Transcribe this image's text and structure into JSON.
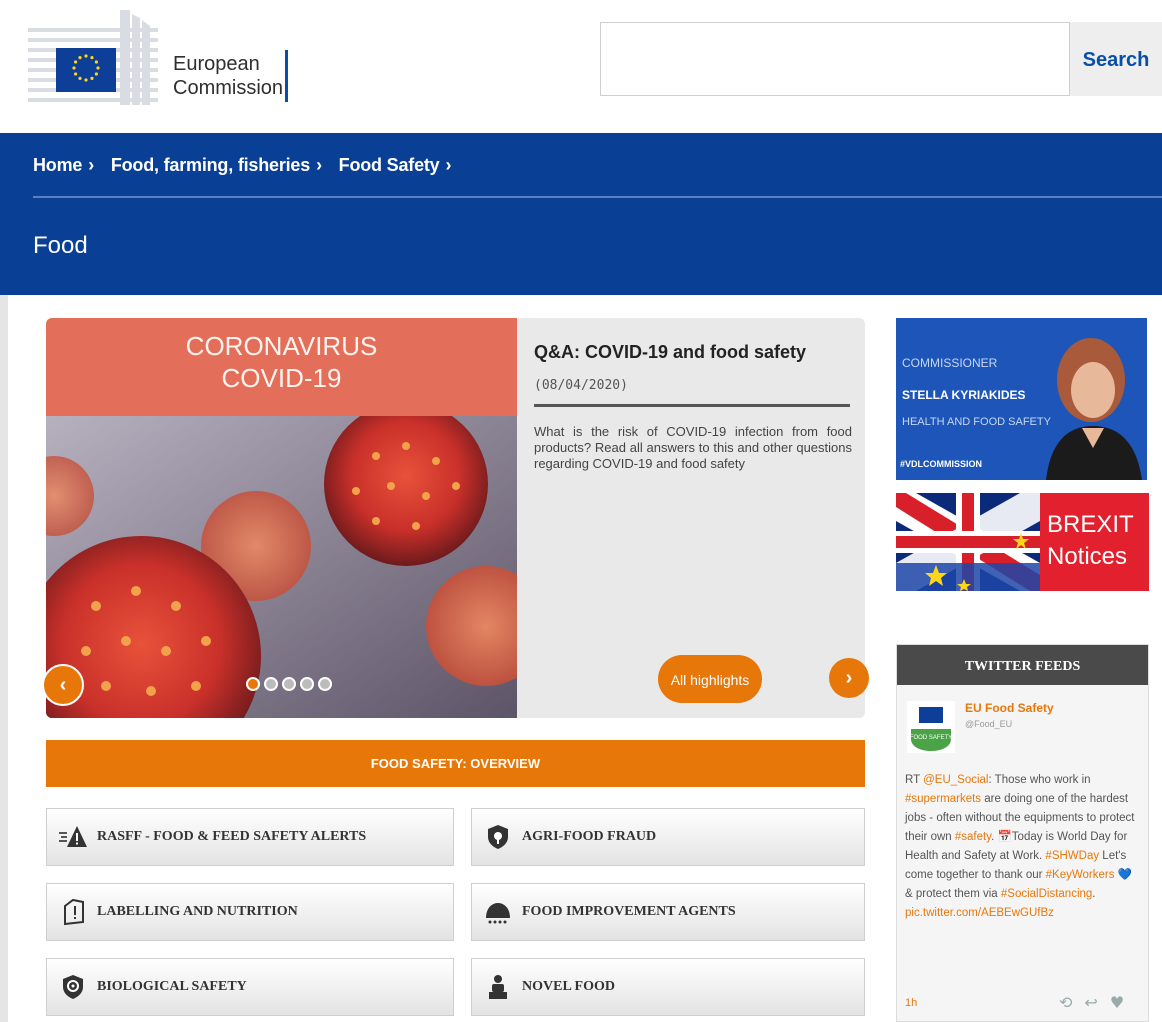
{
  "header": {
    "logo_line1": "European",
    "logo_line2": "Commission",
    "search_value": "",
    "search_label": "Search"
  },
  "breadcrumb": [
    "Home",
    "Food, farming, fisheries",
    "Food Safety"
  ],
  "breadcrumb_separator": "›",
  "page_title": "Food",
  "slider": {
    "banner_line1": "CORONAVIRUS",
    "banner_line2": "COVID-19",
    "title": "Q&A: COVID-19 and food safety",
    "date": "(08/04/2020)",
    "body": "What is the risk of COVID-19 infection from food products? Read all answers to this and other questions regarding COVID-19 and food safety",
    "highlights_label": "All highlights",
    "prev_icon": "‹",
    "next_icon": "›",
    "dot_count": 5,
    "active_dot": 0
  },
  "overview_label": "FOOD SAFETY: OVERVIEW",
  "tiles": [
    {
      "label": "RASFF - FOOD & FEED SAFETY ALERTS",
      "icon": "alert-icon"
    },
    {
      "label": "AGRI-FOOD FRAUD",
      "icon": "shield-icon"
    },
    {
      "label": "LABELLING AND NUTRITION",
      "icon": "label-tag-icon"
    },
    {
      "label": "FOOD IMPROVEMENT AGENTS",
      "icon": "food-agents-icon"
    },
    {
      "label": "BIOLOGICAL SAFETY",
      "icon": "bio-shield-icon"
    },
    {
      "label": "NOVEL FOOD",
      "icon": "novel-food-icon"
    }
  ],
  "commissioner": {
    "line1": "COMMISSIONER",
    "line2": "STELLA KYRIAKIDES",
    "line3": "HEALTH AND FOOD SAFETY",
    "hashtag": "#VDLCOMMISSION"
  },
  "brexit": {
    "line1": "BREXIT",
    "line2": "Notices"
  },
  "twitter": {
    "heading": "TWITTER FEEDS",
    "account_name": "EU Food Safety",
    "handle": "@Food_EU",
    "avatar_text": "FOOD SAFETY",
    "time": "1h",
    "segments": [
      {
        "t": "RT ",
        "h": false
      },
      {
        "t": "@EU_Social",
        "h": true
      },
      {
        "t": ": Those who work in ",
        "h": false
      },
      {
        "t": "#supermarkets",
        "h": true
      },
      {
        "t": " are doing one of the hardest jobs - often without the equipments to protect their own ",
        "h": false
      },
      {
        "t": "#safety",
        "h": true
      },
      {
        "t": ". 📅Today is World Day for Health and Safety at Work. ",
        "h": false
      },
      {
        "t": "#SHWDay",
        "h": true
      },
      {
        "t": " Let's come together to thank our ",
        "h": false
      },
      {
        "t": "#KeyWorkers",
        "h": true
      },
      {
        "t": " 💙 & protect them via ",
        "h": false
      },
      {
        "t": "#SocialDistancing",
        "h": true
      },
      {
        "t": ". ",
        "h": false
      },
      {
        "t": "pic.twitter.com/AEBEwGUfBz",
        "h": true
      }
    ],
    "actions": [
      "⟲",
      "↩",
      "♥"
    ]
  }
}
